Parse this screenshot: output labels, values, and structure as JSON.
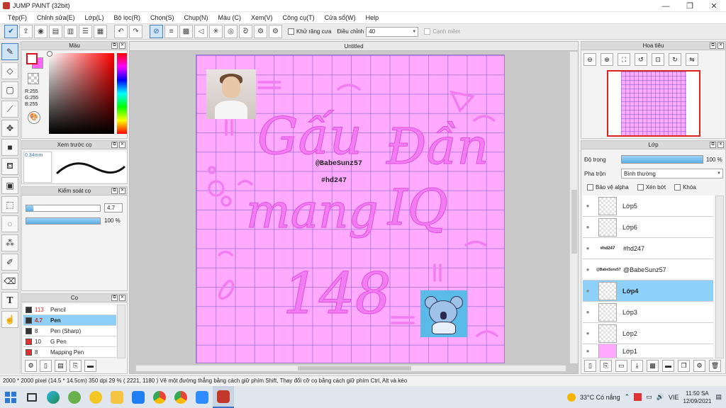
{
  "window": {
    "title": "JUMP PAINT (32bit)"
  },
  "menu": [
    "Tệp(F)",
    "Chỉnh sửa(E)",
    "Lớp(L)",
    "Bộ lọc(R)",
    "Chọn(S)",
    "Chụp(N)",
    "Màu (C)",
    "Xem(V)",
    "Công cụ(T)",
    "Cửa sổ(W)",
    "Help"
  ],
  "toolbar": {
    "antialias_label": "Khử răng cưa",
    "adjust_label": "Điều chỉnh",
    "adjust_value": "40",
    "edge_label": "Cạnh mềm"
  },
  "color_panel": {
    "title": "Màu",
    "r": "R:255",
    "g": "G:255",
    "b": "B:255",
    "fg": "#ffffff",
    "bg": "#ff66ff"
  },
  "preview_panel": {
    "title": "Xem trước cọ",
    "size": "0.34mm"
  },
  "control_panel": {
    "title": "Kiểm soát cọ",
    "size_value": "4.7",
    "size_fraction": 0.1,
    "opacity_value": "100 %",
    "opacity_fraction": 1.0
  },
  "brush_panel": {
    "title": "Cọ",
    "items": [
      {
        "size": "113",
        "name": "Pencil",
        "color": "#333333"
      },
      {
        "size": "4.7",
        "name": "Pen",
        "color": "#333333",
        "selected": true
      },
      {
        "size": "8",
        "name": "Pen (Sharp)",
        "color": "#333333"
      },
      {
        "size": "10",
        "name": "G Pen",
        "color": "#e23030"
      },
      {
        "size": "8",
        "name": "Mapping Pen",
        "color": "#e23030"
      }
    ]
  },
  "canvas": {
    "tab": "Untitled",
    "tag1": "@BabeSunz57",
    "tag2": "#hd247",
    "bg": "#ffaaff"
  },
  "navigator": {
    "title": "Hoa tiêu"
  },
  "layers_panel": {
    "title": "Lớp",
    "opacity_label": "Độ trong",
    "opacity_value": "100 %",
    "blend_label": "Pha trộn",
    "blend_value": "Bình thường",
    "protect_alpha": "Bảo vệ alpha",
    "clip": "Xén bớt",
    "lock": "Khóa",
    "layers": [
      {
        "name": "Lớp5",
        "thumb": "transparent"
      },
      {
        "name": "Lớp6",
        "thumb": "transparent"
      },
      {
        "name": "#hd247",
        "thumb": "text",
        "thumb_text": "#hd247"
      },
      {
        "name": "@BabeSunz57",
        "thumb": "text",
        "thumb_text": "@BabeSunz57"
      },
      {
        "name": "Lớp4",
        "thumb": "transparent",
        "selected": true
      },
      {
        "name": "Lớp3",
        "thumb": "transparent"
      },
      {
        "name": "Lớp2",
        "thumb": "transparent"
      },
      {
        "name": "Lớp1",
        "thumb": "pink"
      }
    ]
  },
  "statusbar": {
    "text": "2000 * 2000 pixel   (14.5 * 14.5cm)   350 dpi   29 %   ( 2221, 1180 )   Vẽ một đường thẳng bằng cách giữ phím Shift, Thay đổi cỡ cọ bằng cách giữ phím Ctrl, Alt và kéo"
  },
  "taskbar": {
    "weather": "33°C  Có nắng",
    "lang": "VIE",
    "time": "11:50 SA",
    "date": "12/09/2021"
  }
}
